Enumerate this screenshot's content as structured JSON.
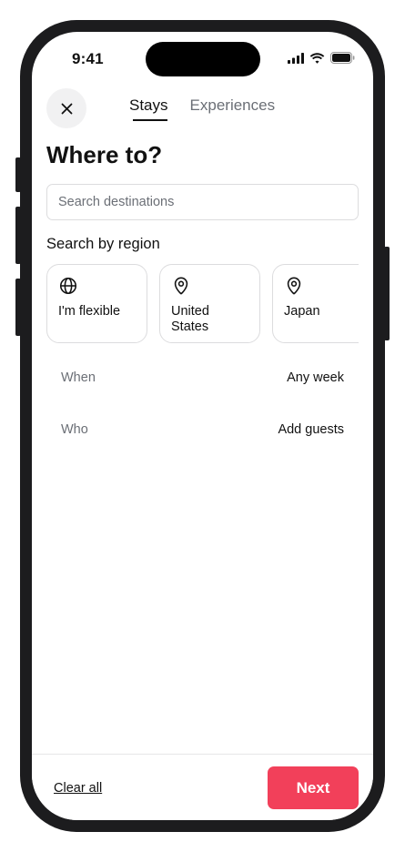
{
  "status_bar": {
    "time": "9:41",
    "icons": [
      "signal-icon",
      "wifi-icon",
      "battery-icon"
    ]
  },
  "header": {
    "close_icon": "close-icon",
    "tabs": [
      {
        "label": "Stays",
        "active": true
      },
      {
        "label": "Experiences",
        "active": false
      }
    ]
  },
  "main": {
    "title": "Where to?",
    "search": {
      "placeholder": "Search destinations",
      "value": ""
    },
    "region_title": "Search by region",
    "regions": [
      {
        "label": "I'm flexible",
        "icon": "globe-icon"
      },
      {
        "label": "United States",
        "icon": "map-pin-icon"
      },
      {
        "label": "Japan",
        "icon": "map-pin-icon"
      }
    ],
    "rows": [
      {
        "label": "When",
        "value": "Any week"
      },
      {
        "label": "Who",
        "value": "Add guests"
      }
    ]
  },
  "footer": {
    "clear_label": "Clear all",
    "next_label": "Next"
  },
  "colors": {
    "accent": "#f2405a",
    "text": "#111111",
    "muted": "#6b6f76",
    "border": "#dcdcde"
  }
}
